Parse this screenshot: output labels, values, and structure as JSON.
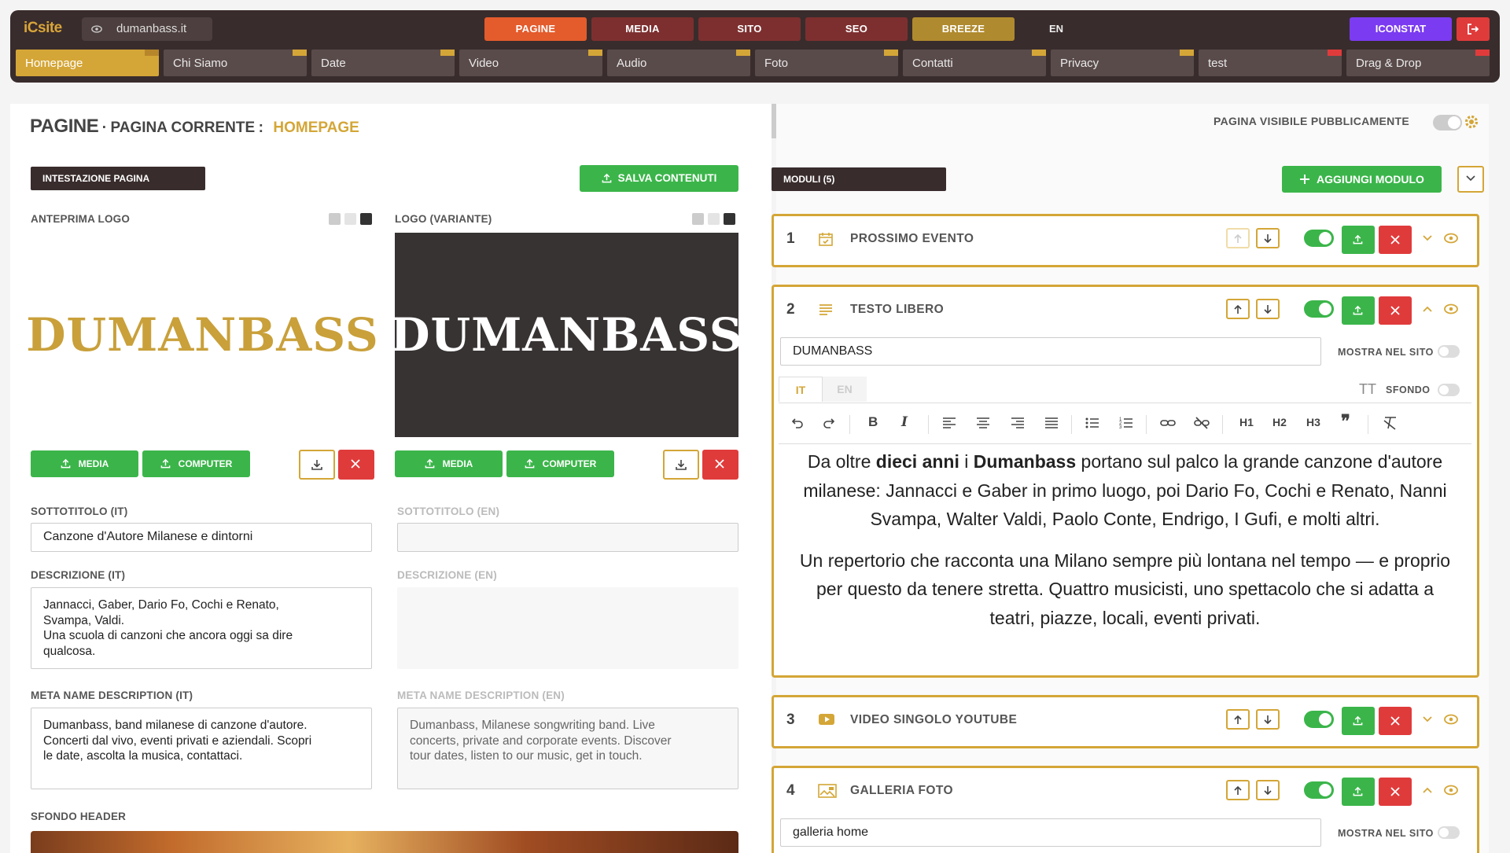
{
  "topbar": {
    "logo": "iCsite",
    "site": "dumanbass.it",
    "nav": [
      {
        "label": "PAGINE",
        "color": "#e45b2c"
      },
      {
        "label": "MEDIA",
        "color": "#7d2f2f"
      },
      {
        "label": "SITO",
        "color": "#7d2f2f"
      },
      {
        "label": "SEO",
        "color": "#7d2f2f"
      },
      {
        "label": "BREEZE",
        "color": "#b08a2e"
      }
    ],
    "lang": "EN",
    "iconstat": "ICONSTAT"
  },
  "page_tabs": [
    {
      "label": "Homepage",
      "corner": "gold"
    },
    {
      "label": "Chi Siamo",
      "corner": "gold"
    },
    {
      "label": "Date",
      "corner": "gold"
    },
    {
      "label": "Video",
      "corner": "gold"
    },
    {
      "label": "Audio",
      "corner": "gold"
    },
    {
      "label": "Foto",
      "corner": "gold"
    },
    {
      "label": "Contatti",
      "corner": "gold"
    },
    {
      "label": "Privacy",
      "corner": "gold"
    },
    {
      "label": "test",
      "corner": "red"
    },
    {
      "label": "Drag & Drop",
      "corner": "red"
    }
  ],
  "header": {
    "pagine": "PAGINE",
    "sep": "·",
    "current_label": "PAGINA CORRENTE",
    "colon": ":",
    "current_page": "HOMEPAGE"
  },
  "left": {
    "section": "INTESTAZIONE PAGINA",
    "save": "SALVA CONTENUTI",
    "logo_preview_label": "ANTEPRIMA LOGO",
    "logo_variant_label": "LOGO (VARIANTE)",
    "logo_text": "DUMANBASS",
    "media_btn": "MEDIA",
    "computer_btn": "COMPUTER",
    "subtitle_it_label": "SOTTOTITOLO (IT)",
    "subtitle_it": "Canzone d'Autore Milanese e dintorni",
    "subtitle_en_label": "SOTTOTITOLO (EN)",
    "subtitle_en": "",
    "desc_it_label": "DESCRIZIONE (IT)",
    "desc_it": "Jannacci, Gaber, Dario Fo, Cochi e Renato,\nSvampa, Valdi.\nUna scuola di canzoni che ancora oggi sa dire\nqualcosa.",
    "desc_en_label": "DESCRIZIONE (EN)",
    "desc_en": "",
    "meta_it_label": "META NAME DESCRIPTION (IT)",
    "meta_it": "Dumanbass, band milanese di canzone d'autore.\nConcerti dal vivo, eventi privati e aziendali. Scopri\nle date, ascolta la musica, contattaci.",
    "meta_en_label": "META NAME DESCRIPTION (EN)",
    "meta_en": "Dumanbass, Milanese songwriting band. Live\nconcerts, private and corporate events. Discover\ntour dates, listen to our music, get in touch.",
    "bg_label": "SFONDO HEADER"
  },
  "right": {
    "visible_label": "PAGINA VISIBILE PUBBLICAMENTE",
    "modules_tag": "MODULI (5)",
    "add_module": "AGGIUNGI MODULO",
    "modules": [
      {
        "num": "1",
        "title": "PROSSIMO EVENTO",
        "icon": "calendar-icon",
        "expanded": false
      },
      {
        "num": "2",
        "title": "TESTO LIBERO",
        "icon": "text-lines-icon",
        "expanded": true
      },
      {
        "num": "3",
        "title": "VIDEO SINGOLO YOUTUBE",
        "icon": "youtube-icon",
        "expanded": false
      },
      {
        "num": "4",
        "title": "GALLERIA FOTO",
        "icon": "gallery-icon",
        "expanded": true
      }
    ],
    "m2": {
      "title_value": "DUMANBASS",
      "show_label": "MOSTRA NEL SITO",
      "tab_it": "IT",
      "tab_en": "EN",
      "tt": "TT",
      "sfondo": "SFONDO",
      "h1": "H1",
      "h2": "H2",
      "h3": "H3",
      "p1_a": "Da oltre ",
      "p1_b": "dieci anni",
      "p1_c": " i ",
      "p1_d": "Dumanbass",
      "p1_e": " portano sul palco la grande canzone d'autore milanese: Jannacci e Gaber in primo luogo, poi Dario Fo, Cochi e Renato, Nanni Svampa, Walter Valdi, Paolo Conte, Endrigo, I Gufi, e molti altri.",
      "p2": "Un repertorio che racconta una Milano sempre più lontana nel tempo — e proprio per questo da tenere stretta. Quattro musicisti, uno spettacolo che si adatta a teatri, piazze, locali, eventi privati."
    },
    "m4": {
      "title_value": "galleria home",
      "show_label": "MOSTRA NEL SITO"
    }
  }
}
